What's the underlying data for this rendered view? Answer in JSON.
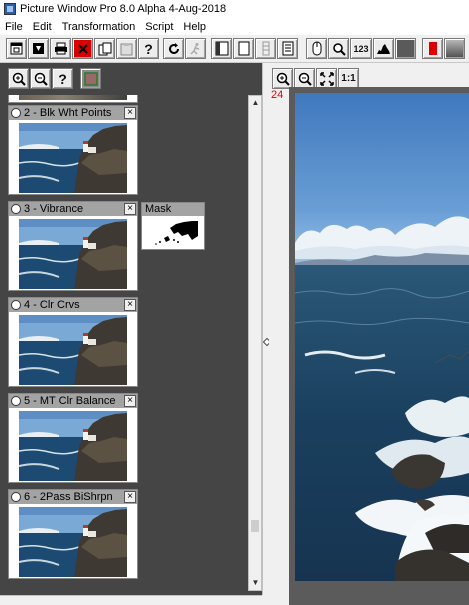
{
  "window": {
    "title": "Picture Window Pro 8.0 Alpha 4-Aug-2018"
  },
  "menubar": {
    "items": [
      "File",
      "Edit",
      "Transformation",
      "Script",
      "Help"
    ]
  },
  "toolbar": {
    "buttons": [
      {
        "name": "new-window-button",
        "icon": "window-icon"
      },
      {
        "name": "open-button",
        "icon": "download-icon"
      },
      {
        "name": "print-button",
        "icon": "printer-icon"
      },
      {
        "name": "close-image-button",
        "icon": "red-x-icon"
      },
      {
        "name": "copy-button",
        "icon": "copy-icon"
      },
      {
        "name": "paste-button",
        "icon": "paste-icon"
      },
      {
        "name": "help-button",
        "icon": "question-icon"
      },
      {
        "name": "refresh-button",
        "icon": "refresh-icon"
      },
      {
        "name": "run-button",
        "icon": "running-man-icon"
      },
      {
        "name": "panel-left-button",
        "icon": "panel-icon"
      },
      {
        "name": "panel-single-button",
        "icon": "panel-icon"
      },
      {
        "name": "panel-split-button",
        "icon": "panel-icon"
      },
      {
        "name": "panel-list-button",
        "icon": "panel-icon"
      },
      {
        "name": "mouse-button",
        "icon": "mouse-icon"
      },
      {
        "name": "zoom-button",
        "icon": "magnifier-icon"
      },
      {
        "name": "readout-button",
        "icon": "readout-icon"
      },
      {
        "name": "histogram-button",
        "icon": "histogram-icon"
      },
      {
        "name": "dark-swatch-button",
        "icon": "swatch-icon"
      },
      {
        "name": "color-bar-button",
        "icon": "red-bar-icon"
      },
      {
        "name": "gradient-button",
        "icon": "gradient-icon"
      }
    ],
    "readout_label": "123"
  },
  "left_panel": {
    "tools": [
      "zoom-in-icon",
      "zoom-out-icon",
      "question-icon",
      "swatch-icon"
    ],
    "help_label": "?",
    "steps": [
      {
        "label": "2 - Blk Wht Points"
      },
      {
        "label": "3 - Vibrance"
      },
      {
        "label": "4 - Clr Crvs"
      },
      {
        "label": "5 - MT Clr Balance"
      },
      {
        "label": "6 - 2Pass BiShrpn"
      }
    ],
    "close_label": "×",
    "mask": {
      "label": "Mask"
    }
  },
  "image_view": {
    "zoom_in_icon": "zoom-in-icon",
    "zoom_out_icon": "zoom-out-icon",
    "fit_icon": "fit-icon",
    "actual_size_label": "1:1",
    "zoom_level": "24"
  },
  "colors": {
    "panel_bg": "#454545",
    "card_header": "#a3a3a3",
    "zoom_text": "#e00000"
  }
}
